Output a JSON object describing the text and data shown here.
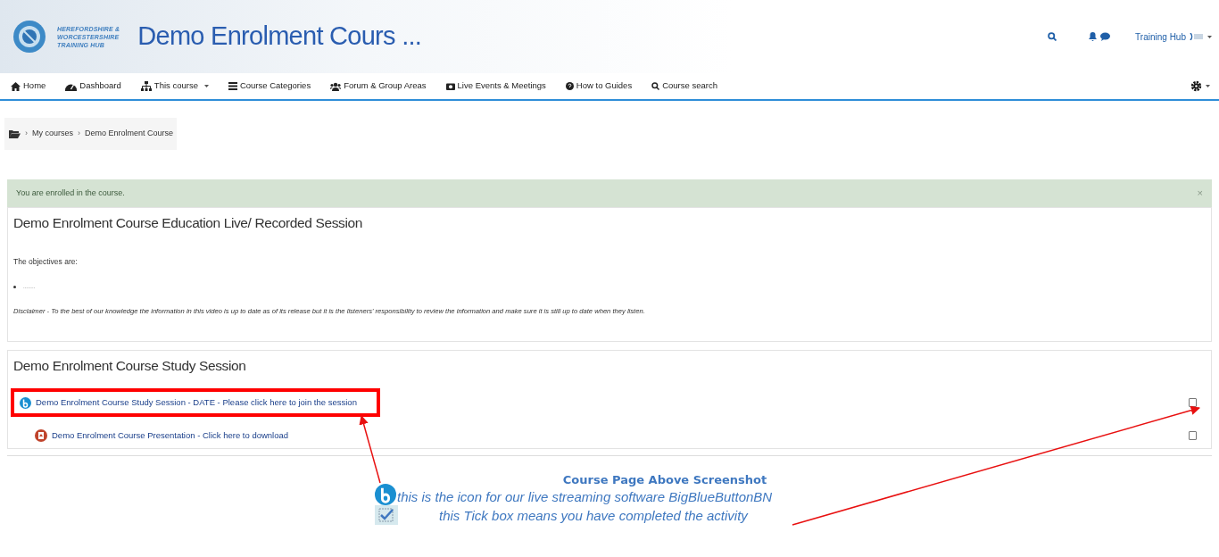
{
  "header": {
    "logo_text": [
      "HEREFORDSHIRE &",
      "WORCESTERSHIRE",
      "TRAINING HUB"
    ],
    "title": "Demo Enrolment Cours ...",
    "user": "Training Hub"
  },
  "nav": [
    {
      "label": "Home",
      "kind": "home"
    },
    {
      "label": "Dashboard",
      "kind": "dashboard"
    },
    {
      "label": "This course",
      "kind": "sitemap",
      "dropdown": true
    },
    {
      "label": "Course Categories",
      "kind": "list"
    },
    {
      "label": "Forum & Group Areas",
      "kind": "users"
    },
    {
      "label": "Live Events & Meetings",
      "kind": "camera"
    },
    {
      "label": "How to Guides",
      "kind": "question"
    },
    {
      "label": "Course search",
      "kind": "search"
    }
  ],
  "breadcrumb": [
    {
      "separator": "›",
      "label": "My courses"
    },
    {
      "separator": "›",
      "label": "Demo Enrolment Course"
    }
  ],
  "alert": {
    "text": "You are enrolled in the course.",
    "close": "×"
  },
  "sections": [
    {
      "title": "Demo Enrolment Course Education Live/ Recorded Session",
      "paragraphs": [
        {
          "kind": "text",
          "text": "The objectives are:"
        },
        {
          "kind": "bullet",
          "text": "........"
        },
        {
          "kind": "italic",
          "text": "Disclaimer - To the best of our knowledge the information in this video is up to date as of its release but it is the listeners' responsibility to review the information and make sure it is still up to date when they listen."
        }
      ]
    },
    {
      "title": "Demo Enrolment Course Study Session",
      "activities": [
        {
          "kind": "bigbluebutton",
          "label": "Demo Enrolment Course Study Session - DATE - Please click here to join the session",
          "highlighted": true,
          "indented": false,
          "checked": false
        },
        {
          "kind": "pdf",
          "label": "Demo Enrolment Course Presentation - Click here to download",
          "highlighted": false,
          "indented": true,
          "checked": false
        }
      ]
    }
  ],
  "annotation": {
    "heading": "Course Page Above Screenshot",
    "lines": [
      "this is the icon for our live streaming software BigBlueButtonBN",
      "this Tick box means you have completed the activity"
    ]
  }
}
